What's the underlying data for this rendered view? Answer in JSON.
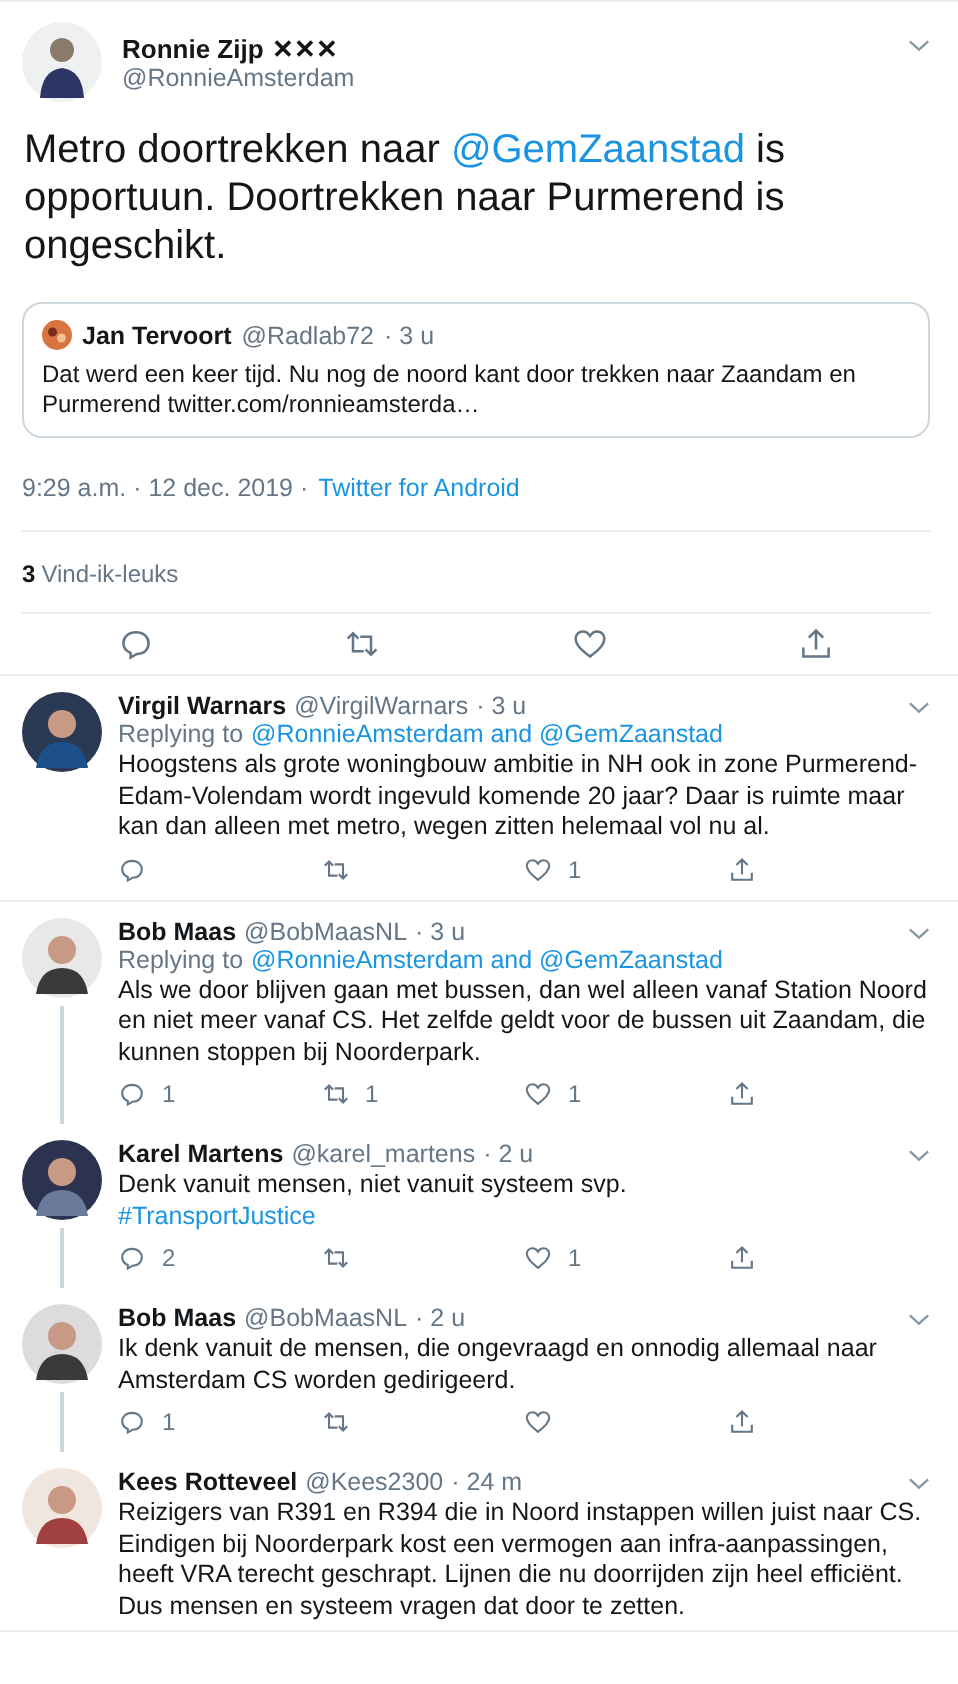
{
  "tweet": {
    "name": "Ronnie Zijp",
    "badge": "✕✕✕",
    "handle": "@RonnieAmsterdam",
    "text": [
      {
        "kind": "plain",
        "text": "Metro doortrekken naar "
      },
      {
        "kind": "link",
        "text": "@GemZaanstad"
      },
      {
        "kind": "plain",
        "text": "  is opportuun. Doortrekken naar Purmerend is ongeschikt."
      }
    ],
    "quote": {
      "name": "Jan Tervoort",
      "handle": "@Radlab72",
      "time": "· 3 u",
      "text": "Dat werd een keer tijd. Nu nog de noord kant door trekken naar Zaandam en Purmerend twitter.com/ronnieamsterda…"
    },
    "time": "9:29 a.m. · 12 dec. 2019 ·",
    "source": "Twitter for Android",
    "likes_count": "3",
    "likes_label": "Vind-ik-leuks"
  },
  "replies": [
    {
      "name": "Virgil Warnars",
      "handle": "@VirgilWarnars",
      "time": "· 3 u",
      "connected": false,
      "replying": {
        "prefix": "Replying to",
        "targets": "@RonnieAmsterdam and @GemZaanstad"
      },
      "text": [
        {
          "kind": "plain",
          "text": "Hoogstens als grote woningbouw ambitie in NH ook in zone Purmerend-Edam-Volendam wordt ingevuld komende 20 jaar? Daar is ruimte maar kan dan alleen met metro, wegen zitten helemaal vol nu al."
        }
      ],
      "counts": {
        "like": "1"
      }
    },
    {
      "name": "Bob Maas",
      "handle": "@BobMaasNL",
      "time": "· 3 u",
      "connected": true,
      "replying": {
        "prefix": "Replying to",
        "targets": "@RonnieAmsterdam and @GemZaanstad"
      },
      "text": [
        {
          "kind": "plain",
          "text": "Als we door blijven gaan met bussen, dan wel alleen vanaf Station Noord en niet meer vanaf CS. Het zelfde geldt voor de bussen uit Zaandam, die kunnen stoppen bij Noorderpark."
        }
      ],
      "counts": {
        "reply": "1",
        "retweet": "1",
        "like": "1"
      }
    },
    {
      "name": "Karel Martens",
      "handle": "@karel_martens",
      "time": "· 2 u",
      "connected": true,
      "text": [
        {
          "kind": "plain",
          "text": "Denk vanuit mensen, niet vanuit systeem svp."
        },
        {
          "kind": "break"
        },
        {
          "kind": "link",
          "text": "#TransportJustice"
        }
      ],
      "counts": {
        "reply": "2",
        "like": "1"
      }
    },
    {
      "name": "Bob Maas",
      "handle": "@BobMaasNL",
      "time": "· 2 u",
      "connected": true,
      "text": [
        {
          "kind": "plain",
          "text": "Ik denk vanuit de mensen, die ongevraagd en onnodig allemaal naar Amsterdam CS worden gedirigeerd."
        }
      ],
      "counts": {
        "reply": "1"
      }
    },
    {
      "name": "Kees Rotteveel",
      "handle": "@Kees2300",
      "time": "· 24 m",
      "connected": false,
      "text": [
        {
          "kind": "plain",
          "text": "Reizigers van R391 en R394 die in Noord instappen willen juist naar CS. Eindigen bij Noorderpark kost een vermogen aan infra-aanpassingen, heeft VRA terecht geschrapt. Lijnen die nu doorrijden zijn heel efficiënt. Dus mensen en systeem vragen dat door te zetten."
        }
      ]
    }
  ]
}
